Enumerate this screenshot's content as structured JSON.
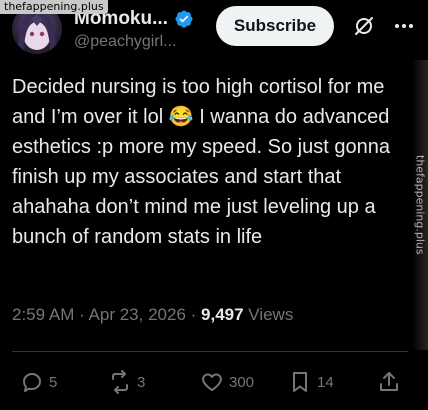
{
  "watermark": {
    "top_text": "thefappening.plus",
    "side_text": "thefappening.plus"
  },
  "author": {
    "display_name": "Momoku...",
    "handle": "@peachygirl..."
  },
  "header": {
    "subscribe_label": "Subscribe"
  },
  "post": {
    "text": "Decided nursing is too high cortisol for me and I’m over it lol 😂 I wanna do advanced esthetics :p more my speed. So just gonna finish up my associates and start that ahahaha don’t mind me just leveling up a bunch of random stats in life"
  },
  "meta": {
    "time": "2:59 AM",
    "sep1": " · ",
    "date": "Apr 23, 2026",
    "sep2": " · ",
    "views_count": "9,497",
    "views_label": " Views"
  },
  "actions": {
    "replies": "5",
    "reposts": "3",
    "likes": "300",
    "bookmarks": "14"
  },
  "colors": {
    "background": "#000000",
    "text": "#e7e9ea",
    "secondary": "#71767b",
    "verified": "#1d9bf0",
    "divider": "#2f3336"
  },
  "icons": {
    "verified": "verified-badge-icon",
    "grok": "grok-icon",
    "more": "more-icon",
    "reply": "reply-icon",
    "repost": "repost-icon",
    "like": "heart-icon",
    "bookmark": "bookmark-icon",
    "share": "share-icon"
  }
}
